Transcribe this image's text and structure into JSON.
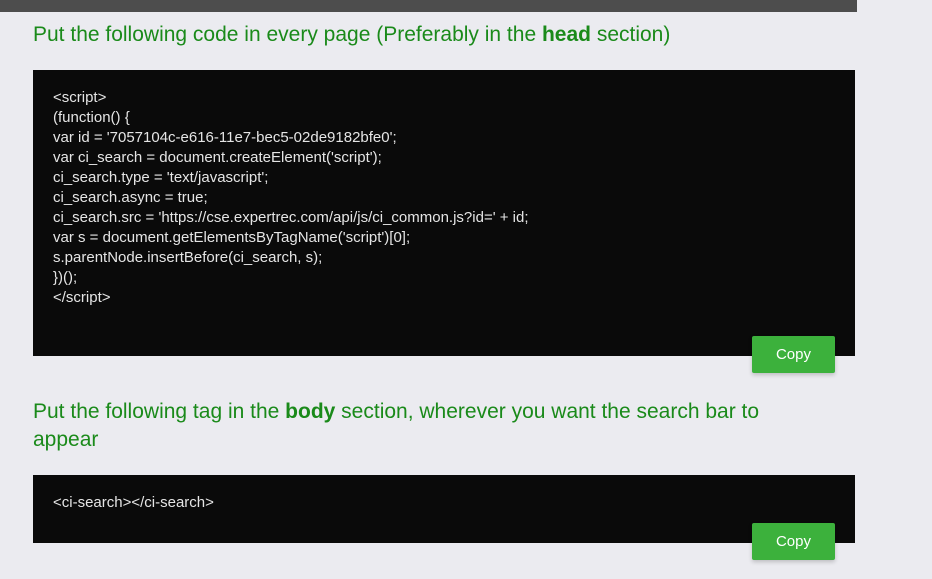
{
  "section1": {
    "heading_pre": "Put the following code in every page (Preferably in the ",
    "heading_bold": "head",
    "heading_post": " section)",
    "code_lines": [
      "<script>",
      "(function() {",
      "var id = '7057104c-e616-11e7-bec5-02de9182bfe0';",
      "var ci_search = document.createElement('script');",
      "ci_search.type = 'text/javascript';",
      "ci_search.async = true;",
      "ci_search.src = 'https://cse.expertrec.com/api/js/ci_common.js?id=' + id;",
      "var s = document.getElementsByTagName('script')[0];",
      "s.parentNode.insertBefore(ci_search, s);",
      "})();",
      "</script>"
    ],
    "copy_label": "Copy"
  },
  "section2": {
    "heading_pre": "Put the following tag in the ",
    "heading_bold": "body",
    "heading_post": " section, wherever you want the search bar to appear",
    "code_lines": [
      "<ci-search></ci-search>"
    ],
    "copy_label": "Copy"
  }
}
